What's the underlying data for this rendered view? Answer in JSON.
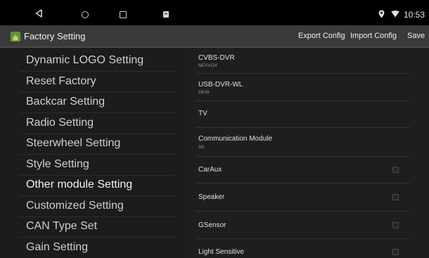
{
  "status_bar": {
    "icons": [
      "back-icon",
      "home-icon",
      "recent-apps-icon",
      "notification-icon",
      "location-icon",
      "wifi-icon"
    ],
    "time": "10:53"
  },
  "action_bar": {
    "title": "Factory Setting",
    "actions": {
      "export": "Export Config",
      "import": "Import Config",
      "save": "Save"
    }
  },
  "menu": {
    "items": [
      {
        "label": "Dynamic LOGO Setting"
      },
      {
        "label": "Reset Factory"
      },
      {
        "label": "Backcar Setting"
      },
      {
        "label": "Radio Setting"
      },
      {
        "label": "Steerwheel Setting"
      },
      {
        "label": "Style Setting"
      },
      {
        "label": "Other module Setting",
        "active": true
      },
      {
        "label": "Customized Setting"
      },
      {
        "label": "CAN Type Set"
      },
      {
        "label": "Gain Setting"
      }
    ]
  },
  "settings": {
    "rows": [
      {
        "title": "CVBS-DVR",
        "value": "NEXVOX"
      },
      {
        "title": "USB-DVR-WL",
        "value": "GKW"
      },
      {
        "title": "TV"
      },
      {
        "title": "Communication Module",
        "value": "3G"
      },
      {
        "title": "CarAux",
        "checked": false
      },
      {
        "title": "Speaker",
        "checked": false
      },
      {
        "title": "GSensor",
        "checked": false
      },
      {
        "title": "Light Sensitive",
        "checked": false
      }
    ]
  }
}
